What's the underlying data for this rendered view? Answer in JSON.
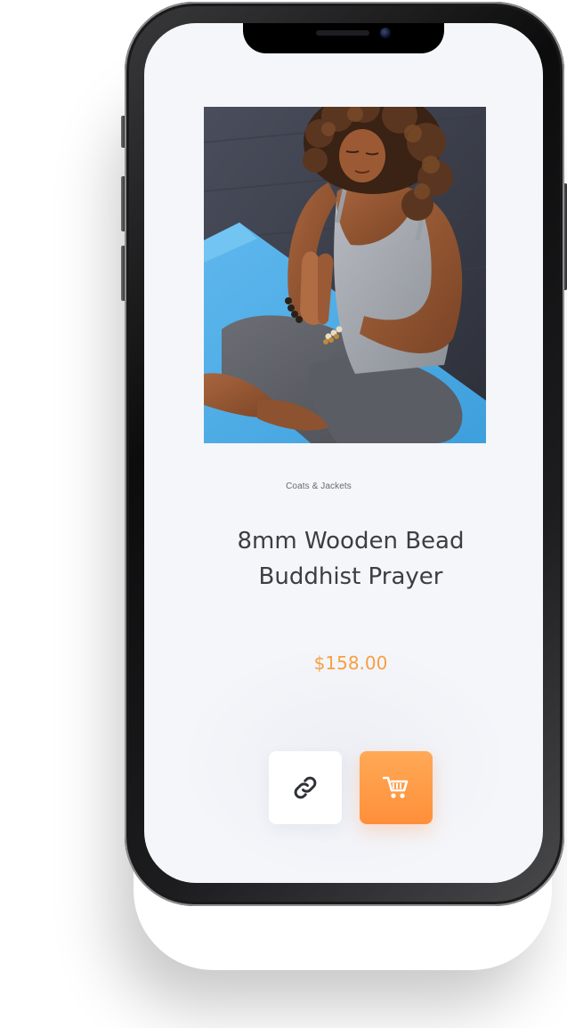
{
  "product": {
    "category": "Coats & Jackets",
    "title": "8mm Wooden Bead Buddhist Prayer",
    "price": "$158.00",
    "image": "woman in grey tank top meditating with prayer hands on blue yoga mat"
  },
  "actions": {
    "link_icon": "link-icon",
    "cart_icon": "shopping-cart-icon"
  },
  "colors": {
    "screen_bg": "#f5f6fa",
    "accent": "#ff9a45",
    "price": "#f6a040",
    "title": "#3d3d45"
  }
}
